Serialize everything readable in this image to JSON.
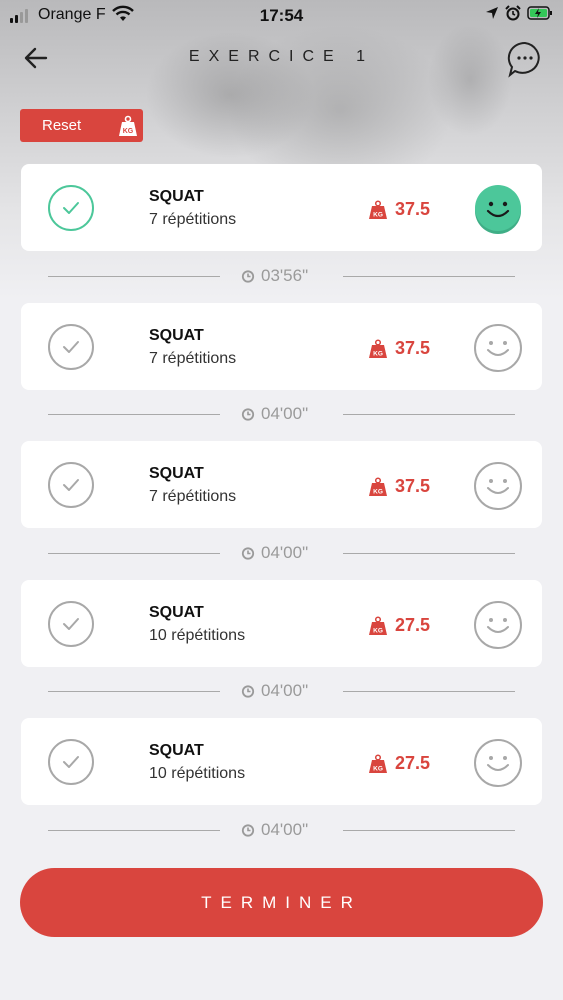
{
  "status_bar": {
    "carrier": "Orange F",
    "time": "17:54"
  },
  "header": {
    "title": "EXERCICE 1"
  },
  "reset": {
    "label": "Reset",
    "icon_text": "KG"
  },
  "sets": [
    {
      "exercise": "SQUAT",
      "reps": "7 répétitions",
      "weight": "37.5",
      "done": true
    },
    {
      "exercise": "SQUAT",
      "reps": "7 répétitions",
      "weight": "37.5",
      "done": false
    },
    {
      "exercise": "SQUAT",
      "reps": "7 répétitions",
      "weight": "37.5",
      "done": false
    },
    {
      "exercise": "SQUAT",
      "reps": "10 répétitions",
      "weight": "27.5",
      "done": false
    },
    {
      "exercise": "SQUAT",
      "reps": "10 répétitions",
      "weight": "27.5",
      "done": false
    }
  ],
  "rests": [
    "03'56\"",
    "04'00\"",
    "04'00\"",
    "04'00\"",
    "04'00\""
  ],
  "finish": {
    "label": "TERMINER"
  },
  "colors": {
    "accent": "#d9453e",
    "done_green": "#4cc79a",
    "muted": "#9a9a9a"
  }
}
